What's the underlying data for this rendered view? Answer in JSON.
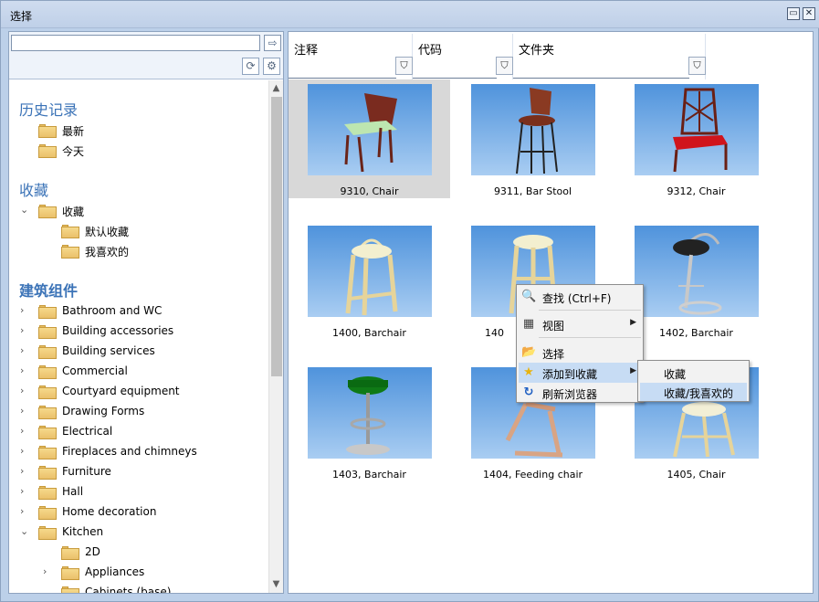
{
  "window": {
    "title": "选择",
    "restore_icon": "restore-icon",
    "close_icon": "close-icon",
    "accent": "#3b73b7"
  },
  "search": {
    "value": "",
    "placeholder": ""
  },
  "tree": {
    "history": {
      "heading": "历史记录",
      "items": [
        "最新",
        "今天"
      ]
    },
    "favorites": {
      "heading": "收藏",
      "root": "收藏",
      "children": [
        "默认收藏",
        "我喜欢的"
      ]
    },
    "components": {
      "heading": "建筑组件",
      "items": [
        "Bathroom and WC",
        "Building accessories",
        "Building services",
        "Commercial",
        "Courtyard equipment",
        "Drawing Forms",
        "Electrical",
        "Fireplaces and chimneys",
        "Furniture",
        "Hall",
        "Home decoration",
        "Kitchen"
      ],
      "kitchen_children": [
        "2D",
        "Appliances",
        "Cabinets (base)"
      ]
    }
  },
  "columns": {
    "notes": "注释",
    "code": "代码",
    "folder": "文件夹"
  },
  "items": [
    {
      "caption": "9310, Chair"
    },
    {
      "caption": "9311, Bar Stool"
    },
    {
      "caption": "9312, Chair"
    },
    {
      "caption": "1400, Barchair"
    },
    {
      "caption": "140"
    },
    {
      "caption": "1402, Barchair"
    },
    {
      "caption": "1403, Barchair"
    },
    {
      "caption": "1404, Feeding chair"
    },
    {
      "caption": "1405, Chair"
    }
  ],
  "context_menu": {
    "find": "查找 (Ctrl+F)",
    "view": "视图",
    "select": "选择",
    "add_favorite": "添加到收藏",
    "refresh": "刷新浏览器"
  },
  "submenu": {
    "favorites": "收藏",
    "favorites_mine": "收藏/我喜欢的"
  }
}
